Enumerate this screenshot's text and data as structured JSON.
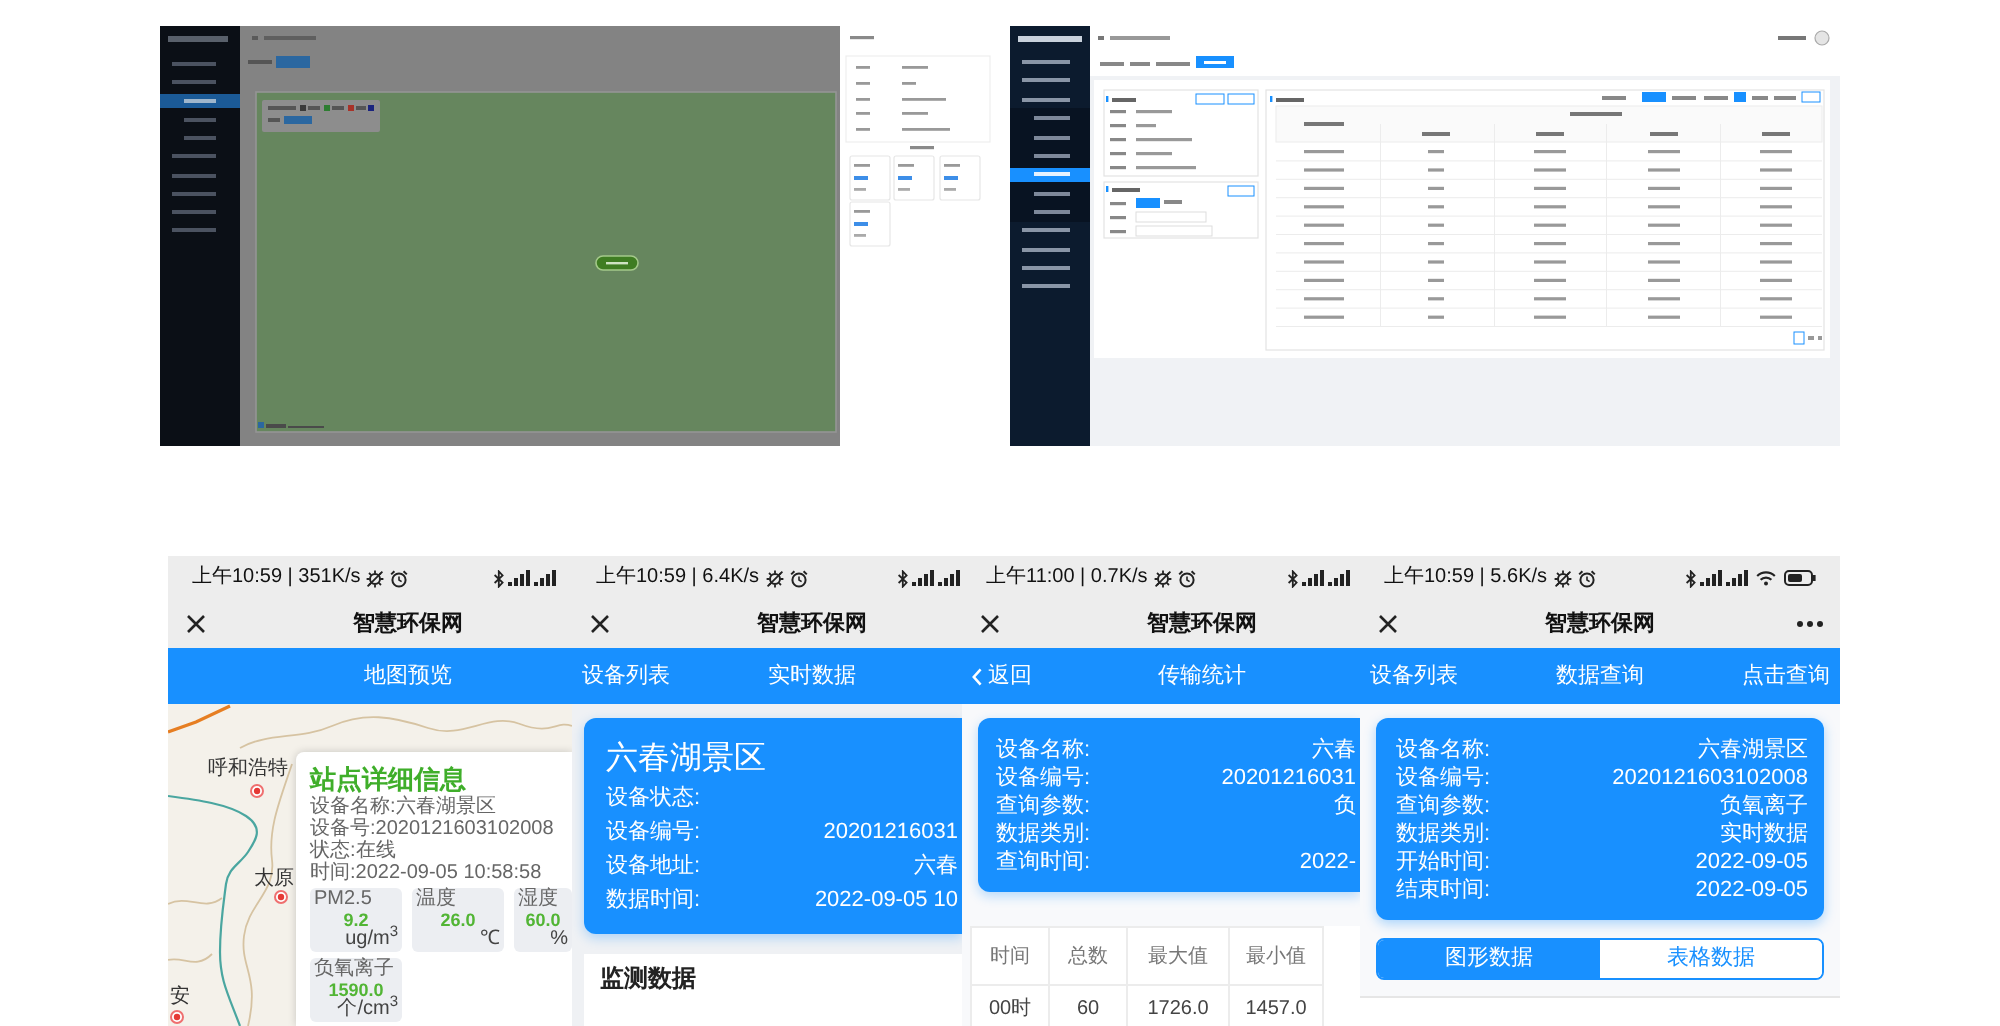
{
  "desktop_screenshots": [
    {
      "kind": "map_view"
    },
    {
      "kind": "table_view"
    }
  ],
  "phones": [
    {
      "status_text": "上午10:59 | 351K/s",
      "title": "智慧环保网",
      "nav": {
        "center": "地图预览"
      },
      "content": {
        "kind": "map",
        "cities": [
          {
            "name": "呼和浩特"
          },
          {
            "name": "太原"
          },
          {
            "name": "安"
          }
        ],
        "popup": {
          "title": "站点详细信息",
          "lines": [
            "设备名称:六春湖景区",
            "设备号:2020121603102008",
            "状态:在线",
            "时间:2022-09-05 10:58:58"
          ],
          "metrics": [
            {
              "label": "PM2.5",
              "value": "9.2",
              "unit": "ug/m$^{3}$"
            },
            {
              "label": "温度",
              "value": "26.0",
              "unit": "℃"
            },
            {
              "label": "湿度",
              "value": "60.0",
              "unit": "%"
            },
            {
              "label": "负氧离子",
              "value": "1590.0",
              "unit": "个/cm$^{3}$"
            }
          ]
        }
      }
    },
    {
      "status_text": "上午10:59 | 6.4K/s",
      "title": "智慧环保网",
      "nav": {
        "left": {
          "kind": "link",
          "label": "设备列表"
        },
        "center": "实时数据"
      },
      "content": {
        "kind": "realtime",
        "card": {
          "title": "六春湖景区",
          "rows": [
            {
              "label": "设备状态:"
            },
            {
              "label": "设备编号:",
              "value": "20201216031"
            },
            {
              "label": "设备地址:",
              "value": "六春"
            },
            {
              "label": "数据时间:",
              "value": "2022-09-05 10"
            }
          ]
        },
        "section": {
          "title": "监测数据"
        }
      }
    },
    {
      "status_text": "上午11:00 | 0.7K/s",
      "title": "智慧环保网",
      "nav": {
        "left": {
          "kind": "back",
          "label": "返回"
        },
        "center": "传输统计"
      },
      "content": {
        "kind": "transfer_stats",
        "card": {
          "rows": [
            {
              "label": "设备名称:",
              "value": "六春"
            },
            {
              "label": "设备编号:",
              "value": "20201216031"
            },
            {
              "label": "查询参数:",
              "value": "负"
            },
            {
              "label": "数据类别:"
            },
            {
              "label": "查询时间:",
              "value": "2022-"
            }
          ]
        },
        "table": {
          "columns": [
            "时间",
            "总数",
            "最大值",
            "最小值"
          ],
          "rows": [
            [
              "00时",
              "60",
              "1726.0",
              "1457.0"
            ]
          ]
        }
      }
    },
    {
      "status_text": "上午10:59 | 5.6K/s",
      "title": "智慧环保网",
      "nav": {
        "left": {
          "kind": "link",
          "label": "设备列表"
        },
        "center": "数据查询",
        "right": {
          "kind": "link",
          "label": "点击查询"
        }
      },
      "content": {
        "kind": "query",
        "card": {
          "rows": [
            {
              "label": "设备名称:",
              "value": "六春湖景区"
            },
            {
              "label": "设备编号:",
              "value": "2020121603102008"
            },
            {
              "label": "查询参数:",
              "value": "负氧离子"
            },
            {
              "label": "数据类别:",
              "value": "实时数据"
            },
            {
              "label": "开始时间:",
              "value": "2022-09-05"
            },
            {
              "label": "结束时间:",
              "value": "2022-09-05"
            }
          ]
        },
        "segments": [
          {
            "label": "图形数据",
            "selected": true
          },
          {
            "label": "表格数据",
            "selected": false
          }
        ]
      }
    }
  ]
}
